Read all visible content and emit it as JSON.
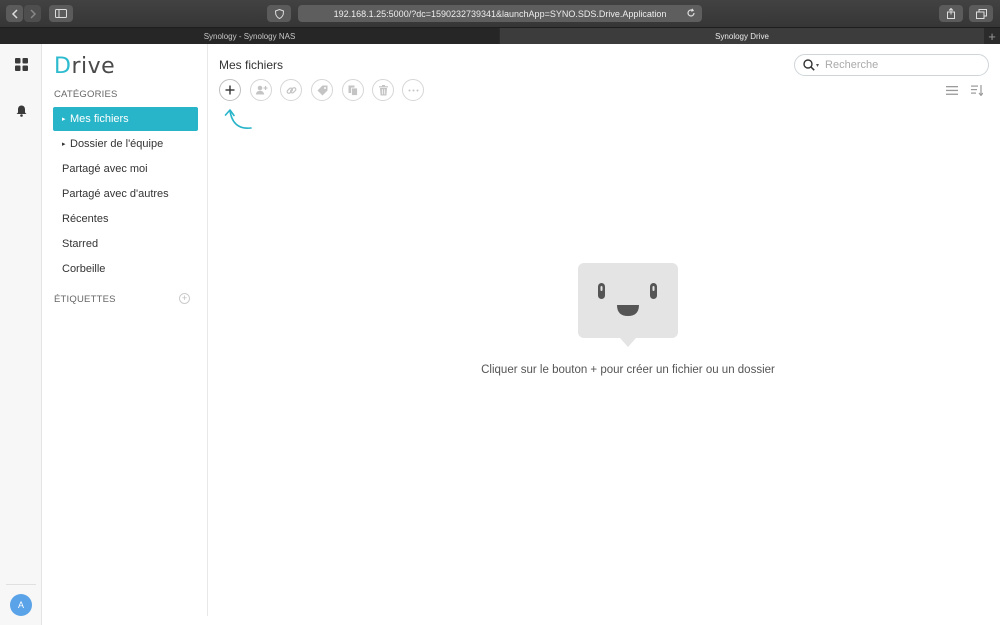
{
  "browser": {
    "url": "192.168.1.25:5000/?dc=1590232739341&launchApp=SYNO.SDS.Drive.Application",
    "tabs": [
      {
        "label": "Synology - Synology NAS",
        "active": false
      },
      {
        "label": "Synology Drive",
        "active": true
      }
    ]
  },
  "rail": {
    "avatar_letter": "A"
  },
  "sidebar": {
    "logo_initial": "D",
    "logo_rest": "rive",
    "categories_label": "CATÉGORIES",
    "items": [
      {
        "label": "Mes fichiers",
        "selected": true,
        "expandable": true
      },
      {
        "label": "Dossier de l'équipe",
        "selected": false,
        "expandable": true
      },
      {
        "label": "Partagé avec moi",
        "selected": false,
        "expandable": false
      },
      {
        "label": "Partagé avec d'autres",
        "selected": false,
        "expandable": false
      },
      {
        "label": "Récentes",
        "selected": false,
        "expandable": false
      },
      {
        "label": "Starred",
        "selected": false,
        "expandable": false
      },
      {
        "label": "Corbeille",
        "selected": false,
        "expandable": false
      }
    ],
    "tags_label": "ÉTIQUETTES"
  },
  "main": {
    "title": "Mes fichiers",
    "search_placeholder": "Recherche",
    "toolbar": [
      "add-icon",
      "share-user-icon",
      "link-icon",
      "tag-icon",
      "copy-icon",
      "trash-icon",
      "more-icon"
    ],
    "empty_message": "Cliquer sur le bouton + pour créer un fichier ou un dossier"
  },
  "colors": {
    "accent": "#28b5c9",
    "avatar": "#5aa3e8"
  }
}
